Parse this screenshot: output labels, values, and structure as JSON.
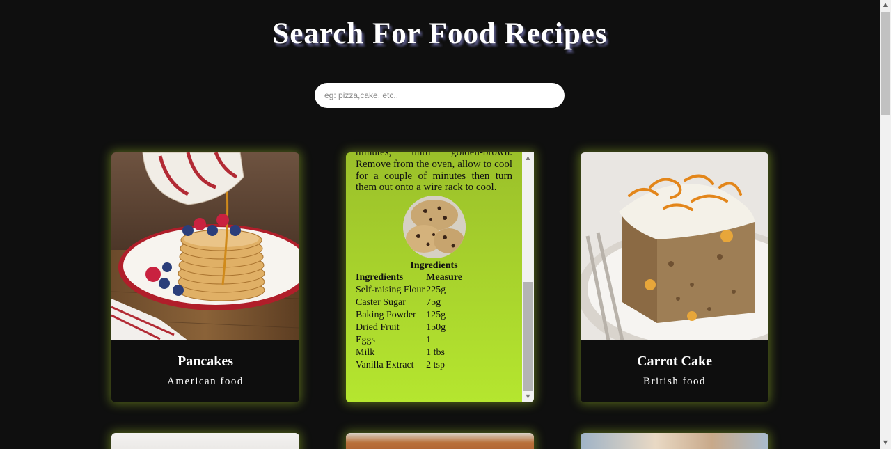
{
  "page": {
    "title": "Search For Food Recipes",
    "search": {
      "placeholder": "eg: pizza,cake, etc.."
    }
  },
  "cards": [
    {
      "name": "Pancakes",
      "origin": "American food",
      "image_icon": "pancakes-photo"
    },
    {
      "name": "Carrot Cake",
      "origin": "British food",
      "image_icon": "carrot-cake-photo"
    }
  ],
  "detail": {
    "instructions": "minutes, until golden-brown. Remove from the oven, allow to cool for a couple of minutes then turn them out onto a wire rack to cool.",
    "ingredients_heading": "Ingredients",
    "columns": [
      "Ingredients",
      "Measure"
    ],
    "rows": [
      [
        "Self-raising Flour",
        "225g"
      ],
      [
        "Caster Sugar",
        "75g"
      ],
      [
        "Baking Powder",
        "125g"
      ],
      [
        "Dried Fruit",
        "150g"
      ],
      [
        "Eggs",
        "1"
      ],
      [
        "Milk",
        "1 tbs"
      ],
      [
        "Vanilla Extract",
        "2 tsp"
      ]
    ]
  },
  "icons": {
    "scroll_up": "▲",
    "scroll_down": "▼"
  },
  "colors": {
    "background": "#0f0f0f",
    "card_glow": "#9bc02a",
    "detail_top": "#9bc02a",
    "detail_bottom": "#b5e62f"
  }
}
